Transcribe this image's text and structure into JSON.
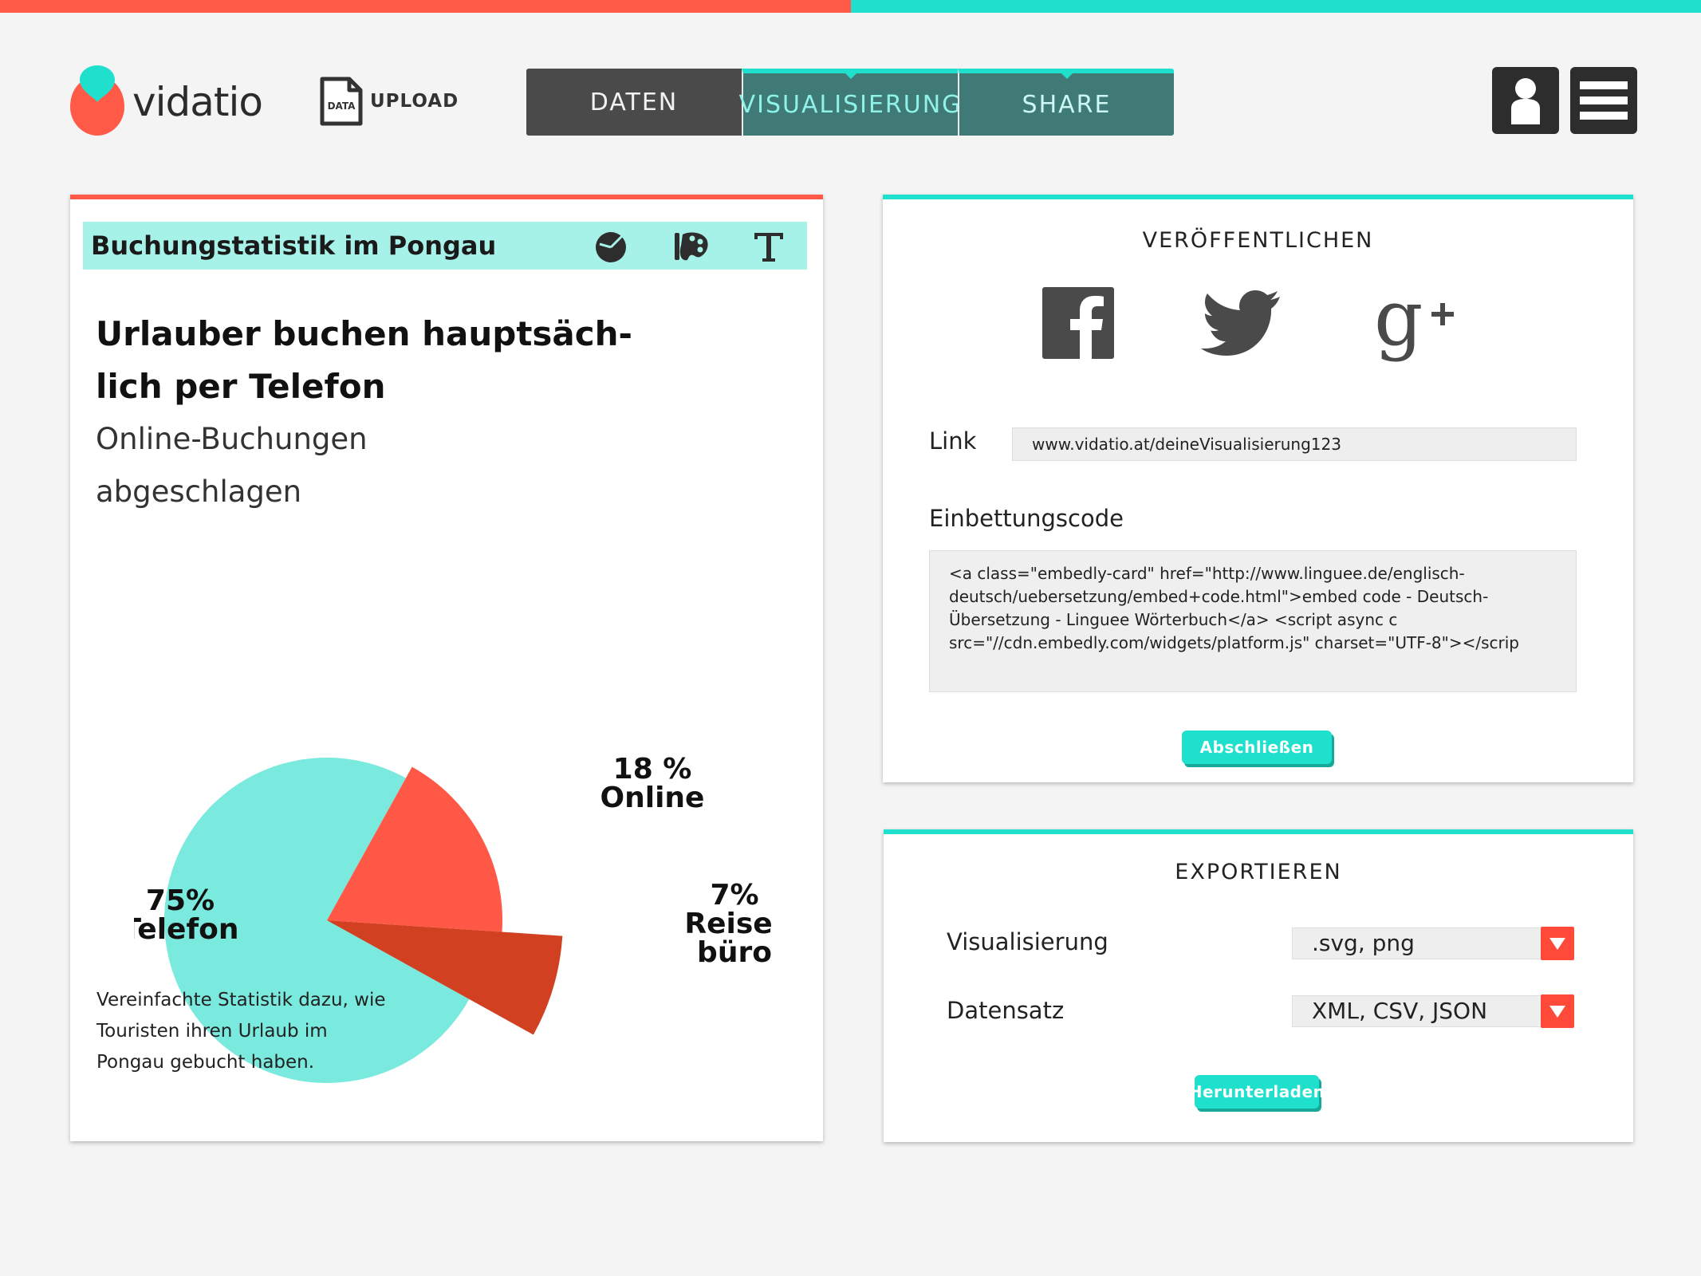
{
  "colors": {
    "coral": "#ff5a48",
    "turquoise": "#1ee0cc",
    "pie_telefon": "#7aeadf",
    "pie_online": "#ff5847",
    "pie_reisebuero": "#d14020",
    "dark": "#4a4a4a"
  },
  "header": {
    "brand": "vidatio",
    "upload": {
      "file_icon_text": "DATA",
      "label": "UPLOAD"
    },
    "tabs": [
      {
        "label": "DATEN"
      },
      {
        "label": "VISUALISIERUNG"
      },
      {
        "label": "SHARE"
      }
    ],
    "icons": {
      "user": "user-icon",
      "menu": "hamburger-menu-icon"
    }
  },
  "visualization": {
    "title": "Buchungstatistik im Pongau",
    "tools": [
      "pie-chart-icon",
      "palette-icon",
      "text-icon"
    ],
    "headline_line1": "Urlauber buchen hauptsäch-",
    "headline_line2": "lich per Telefon",
    "subhead_line1": "Online-Buchungen",
    "subhead_line2": "abgeschlagen",
    "caption_line1": "Vereinfachte Statistik dazu, wie",
    "caption_line2": "Touristen ihren Urlaub im",
    "caption_line3": "Pongau gebucht haben."
  },
  "chart_data": {
    "type": "pie",
    "categories": [
      "Telefon",
      "Online",
      "Reisebüro"
    ],
    "values": [
      75,
      18,
      7
    ],
    "data_labels": [
      [
        "75%",
        "Telefon"
      ],
      [
        "18 %",
        "Online"
      ],
      [
        "7%",
        "Reise-",
        "büro"
      ]
    ]
  },
  "publish": {
    "heading": "VERÖFFENTLICHEN",
    "social": [
      "facebook-icon",
      "twitter-icon",
      "google-plus-icon"
    ],
    "link_label": "Link",
    "link_value": "www.vidatio.at/deineVisualisierung123",
    "embed_label": "Einbettungscode",
    "embed_value": "<a class=\"embedly-card\" href=\"http://www.linguee.de/englisch-deutsch/uebersetzung/embed+code.html\">embed code - Deutsch-Übersetzung - Linguee Wörterbuch</a> <script async c src=\"//cdn.embedly.com/widgets/platform.js\" charset=\"UTF-8\"></scrip",
    "finish_label": "Abschließen"
  },
  "export": {
    "heading": "EXPORTIEREN",
    "vis_label": "Visualisierung",
    "vis_value": ".svg, png",
    "data_label": "Datensatz",
    "data_value": "XML, CSV, JSON",
    "download_label": "Herunterladen"
  }
}
